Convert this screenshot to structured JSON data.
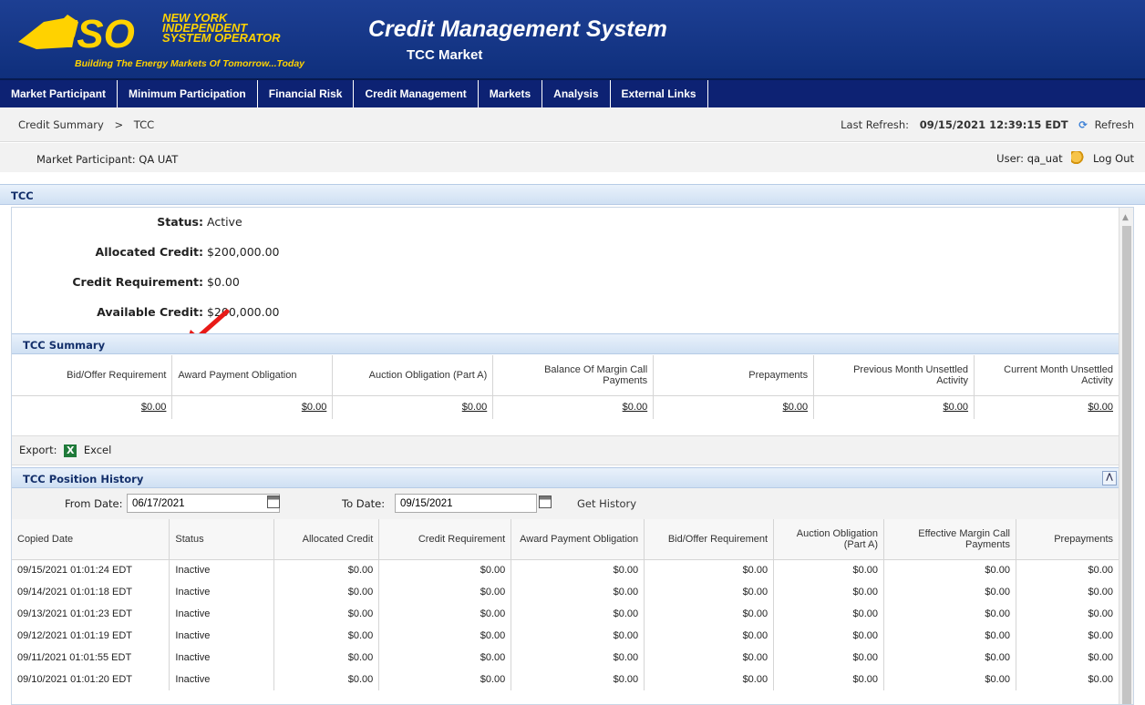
{
  "header": {
    "logo_name_lines": [
      "NEW YORK",
      "INDEPENDENT",
      "SYSTEM OPERATOR"
    ],
    "logo_mark": "ISO",
    "logo_tagline": "Building The Energy Markets Of Tomorrow...Today",
    "title": "Credit Management System",
    "subtitle": "TCC Market"
  },
  "nav": [
    "Market Participant",
    "Minimum Participation",
    "Financial Risk",
    "Credit Management",
    "Markets",
    "Analysis",
    "External Links"
  ],
  "breadcrumb": {
    "items": [
      "Credit Summary",
      "TCC"
    ],
    "separator": ">"
  },
  "refresh": {
    "label": "Last Refresh:",
    "timestamp": "09/15/2021 12:39:15 EDT",
    "button": "Refresh"
  },
  "participant": {
    "label": "Market Participant: QA UAT"
  },
  "user": {
    "label": "User: qa_uat",
    "logout": "Log Out"
  },
  "tcc": {
    "section_title": "TCC",
    "status": {
      "label": "Status:",
      "value": "Active"
    },
    "allocated": {
      "label": "Allocated Credit:",
      "value": "$200,000.00"
    },
    "requirement": {
      "label": "Credit Requirement:",
      "value": "$0.00"
    },
    "available": {
      "label": "Available Credit:",
      "value": "$200,000.00"
    }
  },
  "summary": {
    "section_title": "TCC Summary",
    "columns": [
      "Bid/Offer Requirement",
      "Award Payment Obligation",
      "Auction Obligation (Part A)",
      "Balance Of Margin Call Payments",
      "Prepayments",
      "Previous Month Unsettled Activity",
      "Current Month Unsettled Activity"
    ],
    "values": [
      "$0.00",
      "$0.00",
      "$0.00",
      "$0.00",
      "$0.00",
      "$0.00",
      "$0.00"
    ]
  },
  "export": {
    "label": "Export:",
    "excel": "Excel"
  },
  "history": {
    "section_title": "TCC Position History",
    "from_label": "From Date:",
    "from_value": "06/17/2021",
    "to_label": "To Date:",
    "to_value": "09/15/2021",
    "get_history": "Get History",
    "columns": [
      "Copied Date",
      "Status",
      "Allocated Credit",
      "Credit Requirement",
      "Award Payment Obligation",
      "Bid/Offer Requirement",
      "Auction Obligation (Part A)",
      "Effective Margin Call Payments",
      "Prepayments"
    ],
    "rows": [
      [
        "09/15/2021 01:01:24 EDT",
        "Inactive",
        "$0.00",
        "$0.00",
        "$0.00",
        "$0.00",
        "$0.00",
        "$0.00",
        "$0.00"
      ],
      [
        "09/14/2021 01:01:18 EDT",
        "Inactive",
        "$0.00",
        "$0.00",
        "$0.00",
        "$0.00",
        "$0.00",
        "$0.00",
        "$0.00"
      ],
      [
        "09/13/2021 01:01:23 EDT",
        "Inactive",
        "$0.00",
        "$0.00",
        "$0.00",
        "$0.00",
        "$0.00",
        "$0.00",
        "$0.00"
      ],
      [
        "09/12/2021 01:01:19 EDT",
        "Inactive",
        "$0.00",
        "$0.00",
        "$0.00",
        "$0.00",
        "$0.00",
        "$0.00",
        "$0.00"
      ],
      [
        "09/11/2021 01:01:55 EDT",
        "Inactive",
        "$0.00",
        "$0.00",
        "$0.00",
        "$0.00",
        "$0.00",
        "$0.00",
        "$0.00"
      ],
      [
        "09/10/2021 01:01:20 EDT",
        "Inactive",
        "$0.00",
        "$0.00",
        "$0.00",
        "$0.00",
        "$0.00",
        "$0.00",
        "$0.00"
      ]
    ]
  },
  "icons": [
    "refresh-icon",
    "key-icon",
    "excel-icon",
    "calendar-icon",
    "collapse-icon",
    "scroll-up-icon",
    "pointer-arrow-icon"
  ],
  "colors": {
    "header_bg": "#0f2f7c",
    "nav_bg": "#0d2273",
    "section_text": "#14306b",
    "logo_yellow": "#ffd200",
    "arrow": "#e81a17"
  }
}
